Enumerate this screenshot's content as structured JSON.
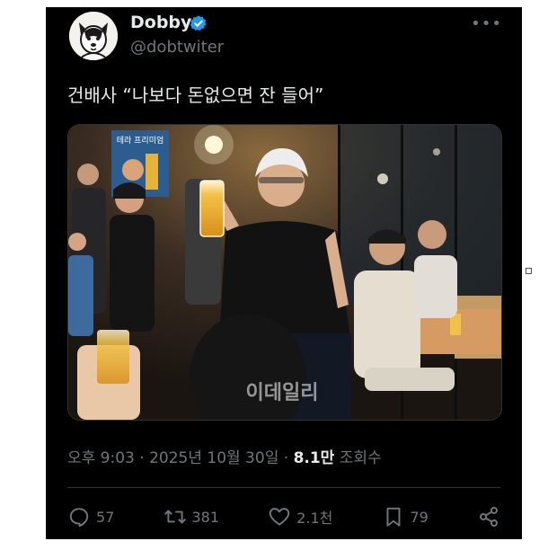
{
  "author": {
    "display_name": "Dobby",
    "handle": "@dobtwiter",
    "verified": true,
    "avatar_icon": "cartoon-dog-avatar"
  },
  "tweet": {
    "text": "건배사 “나보다 돈없으면 잔 들어”",
    "media": {
      "watermark": "이데일리",
      "poster_text": "테라 프리미엄",
      "description_icon": "photo-man-raising-beer-glass"
    }
  },
  "meta": {
    "time": "오후 9:03",
    "separator": " · ",
    "date": "2025년 10월 30일",
    "views_count": "8.1만",
    "views_label": "조회수"
  },
  "actions": {
    "replies": "57",
    "reposts": "381",
    "likes": "2.1천",
    "bookmarks": "79"
  },
  "colors": {
    "background": "#000000",
    "text_primary": "#e7e9ea",
    "text_secondary": "#71767b",
    "verified_blue": "#1d9bf0",
    "divider": "#2f3336"
  }
}
